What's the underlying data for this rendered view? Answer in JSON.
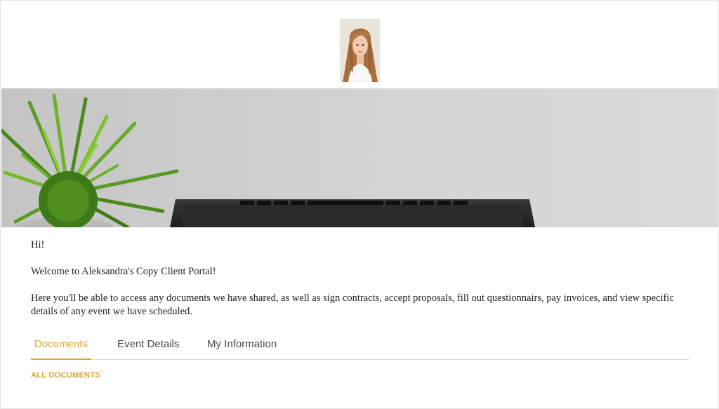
{
  "profile": {
    "photo_icon": "profile-photo"
  },
  "banner": {
    "image": "desk-with-plant-and-laptop"
  },
  "message": {
    "greeting": "Hi!",
    "welcome": "Welcome to Aleksandra's Copy Client Portal!",
    "description": "Here you'll be able to access any documents we have shared, as well as sign contracts, accept proposals, fill out questionnairs, pay invoices, and view specific details of any event we have scheduled."
  },
  "tabs": [
    {
      "label": "Documents",
      "active": true
    },
    {
      "label": "Event Details",
      "active": false
    },
    {
      "label": "My Information",
      "active": false
    }
  ],
  "documents": {
    "filter_label": "ALL DOCUMENTS"
  },
  "colors": {
    "accent": "#e0a52a",
    "text": "#222222",
    "tab_text": "#4a4a4a",
    "divider": "#dadada"
  }
}
